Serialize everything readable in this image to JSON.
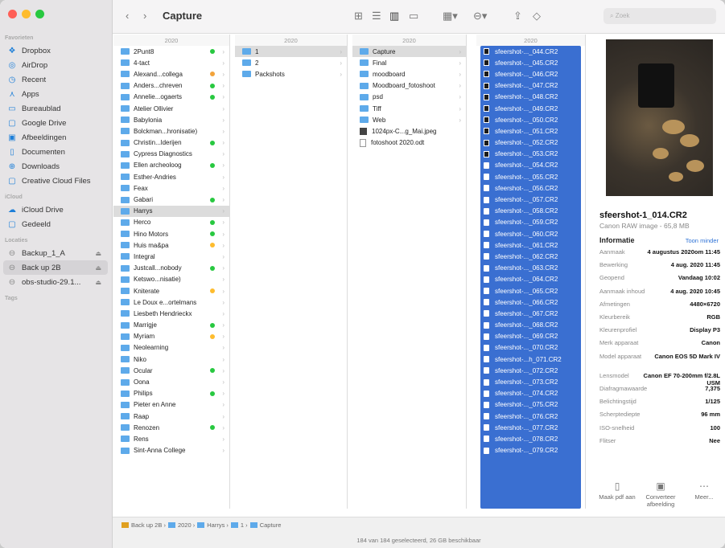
{
  "toolbar": {
    "back": "‹",
    "forward": "›",
    "title": "Capture",
    "search_placeholder": "Zoek"
  },
  "sidebar": {
    "favorites_label": "Favorieten",
    "icloud_label": "iCloud",
    "locations_label": "Locaties",
    "tags_label": "Tags",
    "favorites": [
      "Dropbox",
      "AirDrop",
      "Recent",
      "Apps",
      "Bureaublad",
      "Google Drive",
      "Afbeeldingen",
      "Documenten",
      "Downloads",
      "Creative Cloud Files"
    ],
    "icloud": [
      "iCloud Drive",
      "Gedeeld"
    ],
    "locations": [
      "Backup_1_A",
      "Back up 2B",
      "obs-studio-29.1..."
    ]
  },
  "columns": {
    "year": "2020",
    "col1": [
      "2Punt8",
      "4-tact",
      "Alexand...collega",
      "Anders...chreven",
      "Annelie...ogaerts",
      "Atelier Ollivier",
      "Babylonia",
      "Bolckman...hronisatie)",
      "Christin...lderijen",
      "Cypress Diagnostics",
      "Ellen archeoloog",
      "Esther-Andries",
      "Feax",
      "Gabari",
      "Harrys",
      "Herco",
      "Hino Motors",
      "Huis ma&pa",
      "Integral",
      "Justcall...nobody",
      "Ketswo...nisatie)",
      "Kniterate",
      "Le Doux e...ortelmans",
      "Liesbeth Hendrieckx",
      "Marrigje",
      "Myriam",
      "Neolearning",
      "Niko",
      "Ocular",
      "Oona",
      "Philips",
      "Pieter en Anne",
      "Raap",
      "Renozen",
      "Rens",
      "Sint-Anna College"
    ],
    "col2": [
      "1",
      "2",
      "Packshots"
    ],
    "col3": [
      "Capture",
      "Final",
      "moodboard",
      "Moodboard_fotoshoot",
      "psd",
      "Tiff",
      "Web",
      "1024px-C...g_Mai.jpeg",
      "fotoshoot 2020.odt"
    ],
    "col4": [
      "sfeershot-..._044.CR2",
      "sfeershot-..._045.CR2",
      "sfeershot-..._046.CR2",
      "sfeershot-..._047.CR2",
      "sfeershot-..._048.CR2",
      "sfeershot-..._049.CR2",
      "sfeershot-..._050.CR2",
      "sfeershot-..._051.CR2",
      "sfeershot-..._052.CR2",
      "sfeershot-..._053.CR2",
      "sfeershot-..._054.CR2",
      "sfeershot-..._055.CR2",
      "sfeershot-..._056.CR2",
      "sfeershot-..._057.CR2",
      "sfeershot-..._058.CR2",
      "sfeershot-..._059.CR2",
      "sfeershot-..._060.CR2",
      "sfeershot-..._061.CR2",
      "sfeershot-..._062.CR2",
      "sfeershot-..._063.CR2",
      "sfeershot-..._064.CR2",
      "sfeershot-..._065.CR2",
      "sfeershot-..._066.CR2",
      "sfeershot-..._067.CR2",
      "sfeershot-..._068.CR2",
      "sfeershot-..._069.CR2",
      "sfeershot-..._070.CR2",
      "sfeershot-...h_071.CR2",
      "sfeershot-..._072.CR2",
      "sfeershot-..._073.CR2",
      "sfeershot-..._074.CR2",
      "sfeershot-..._075.CR2",
      "sfeershot-..._076.CR2",
      "sfeershot-..._077.CR2",
      "sfeershot-..._078.CR2",
      "sfeershot-..._079.CR2"
    ]
  },
  "preview": {
    "title": "sfeershot-1_014.CR2",
    "subtitle": "Canon RAW image - 65,8 MB",
    "info_label": "Informatie",
    "show_less": "Toon minder",
    "fields": [
      {
        "k": "Aanmaak",
        "v": "4 augustus 2020om 11:45"
      },
      {
        "k": "Bewerking",
        "v": "4 aug. 2020 11:45"
      },
      {
        "k": "Geopend",
        "v": "Vandaag 10:02"
      },
      {
        "k": "Aanmaak inhoud",
        "v": "4 aug. 2020 10:45"
      },
      {
        "k": "Afmetingen",
        "v": "4480×6720"
      },
      {
        "k": "Kleurbereik",
        "v": "RGB"
      },
      {
        "k": "Kleurenprofiel",
        "v": "Display P3"
      },
      {
        "k": "Merk apparaat",
        "v": "Canon"
      },
      {
        "k": "Model apparaat",
        "v": "Canon EOS 5D Mark IV"
      },
      {
        "k": "Lensmodel",
        "v": "Canon EF 70-200mm f/2.8L USM"
      },
      {
        "k": "Diafragmawaarde",
        "v": "7,375"
      },
      {
        "k": "Belichtingstijd",
        "v": "1/125"
      },
      {
        "k": "Scherptediepte",
        "v": "96 mm"
      },
      {
        "k": "ISO-snelheid",
        "v": "100"
      },
      {
        "k": "Flitser",
        "v": "Nee"
      }
    ],
    "actions": [
      "Maak pdf aan",
      "Converteer afbeelding",
      "Meer..."
    ]
  },
  "path": [
    "Back up 2B",
    "2020",
    "Harrys",
    "1",
    "Capture"
  ],
  "status": "184 van 184 geselecteerd, 26 GB beschikbaar",
  "colors": {
    "accent": "#3a6fd1",
    "folder": "#5eaaea",
    "red": "#ff5f57",
    "yellow": "#febc2e",
    "green": "#28c840"
  }
}
